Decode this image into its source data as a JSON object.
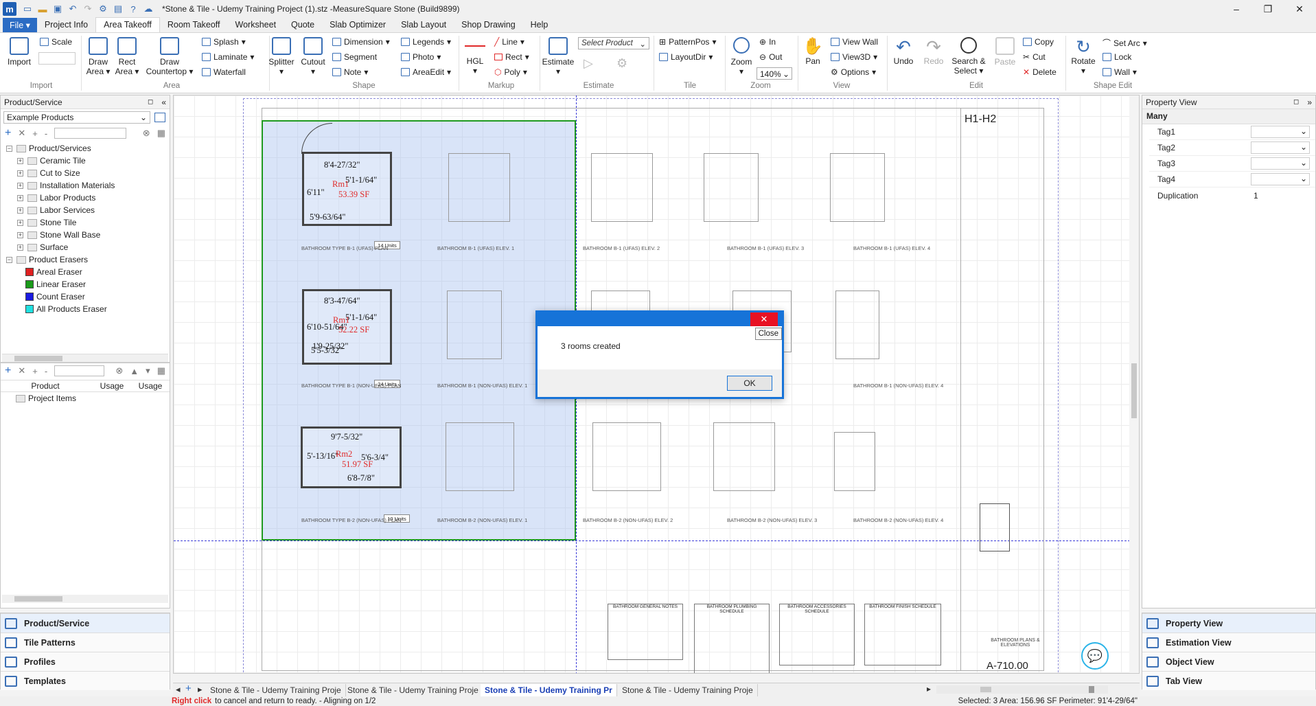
{
  "window": {
    "title": "*Stone & Tile - Udemy Training Project (1).stz -MeasureSquare Stone (Build9899)",
    "logo": "m",
    "minimize": "–",
    "restore": "❐",
    "close": "✕"
  },
  "menu": [
    "File ▾",
    "Project Info",
    "Area Takeoff",
    "Room Takeoff",
    "Worksheet",
    "Quote",
    "Slab Optimizer",
    "Slab Layout",
    "Shop Drawing",
    "Help"
  ],
  "ribbon": {
    "import": "Import",
    "scale": "Scale",
    "draw_area": "Draw\nArea ▾",
    "rect_area": "Rect\nArea ▾",
    "draw_countertop": "Draw\nCountertop ▾",
    "splash": "Splash",
    "laminate": "Laminate",
    "waterfall": "Waterfall",
    "splitter": "Splitter",
    "cutout": "Cutout",
    "dimension": "Dimension",
    "segment": "Segment",
    "note": "Note",
    "legends": "Legends",
    "photo": "Photo",
    "areaedit": "AreaEdit",
    "hgl": "HGL",
    "line": "Line",
    "rect": "Rect",
    "poly": "Poly",
    "estimate": "Estimate",
    "select_product": "Select Product",
    "patternpos": "PatternPos",
    "layoutdir": "LayoutDir",
    "zoom": "Zoom",
    "zoom_in": "In",
    "zoom_out": "Out",
    "zoom_level": "140%",
    "pan": "Pan",
    "view_wall": "View Wall",
    "view3d": "View3D",
    "options": "Options",
    "undo": "Undo",
    "redo": "Redo",
    "search_select": "Search &\nSelect ▾",
    "paste": "Paste",
    "copy": "Copy",
    "cut": "Cut",
    "delete": "Delete",
    "rotate": "Rotate",
    "set_arc": "Set Arc",
    "lock": "Lock",
    "wall": "Wall",
    "groups": {
      "import": "Import",
      "area": "Area",
      "shape": "Shape",
      "markup": "Markup",
      "estimate": "Estimate",
      "tile": "Tile",
      "zoom": "Zoom",
      "view": "View",
      "edit": "Edit",
      "shape_edit": "Shape Edit"
    }
  },
  "left_panel": {
    "title": "Product/Service",
    "dropdown": "Example Products",
    "tree_root": "Product/Services",
    "items": [
      "Ceramic Tile",
      "Cut to Size",
      "Installation Materials",
      "Labor Products",
      "Labor Services",
      "Stone Tile",
      "Stone Wall Base",
      "Surface"
    ],
    "erasers_root": "Product Erasers",
    "erasers": [
      {
        "label": "Areal Eraser",
        "color": "#e02020"
      },
      {
        "label": "Linear Eraser",
        "color": "#1a9a1a"
      },
      {
        "label": "Count Eraser",
        "color": "#1a1ae0"
      },
      {
        "label": "All Products Eraser",
        "color": "#20e0e0"
      }
    ],
    "columns": [
      "Product",
      "Usage",
      "Usage"
    ],
    "project_items": "Project Items",
    "nav": [
      "Product/Service",
      "Tile Patterns",
      "Profiles",
      "Templates"
    ]
  },
  "right_panel": {
    "title": "Property View",
    "selection": "Many",
    "props": [
      {
        "label": "Tag1",
        "value": ""
      },
      {
        "label": "Tag2",
        "value": ""
      },
      {
        "label": "Tag3",
        "value": ""
      },
      {
        "label": "Tag4",
        "value": ""
      },
      {
        "label": "Duplication",
        "value": "1"
      }
    ],
    "nav": [
      "Property View",
      "Estimation View",
      "Object View",
      "Tab View"
    ]
  },
  "drawing": {
    "sheet_id": "H1-H2",
    "sheet_number": "A-710.00",
    "rooms": [
      {
        "top": "8'4-27/32\"",
        "right": "5'1-1/64\"",
        "left": "6'11\"",
        "bottom": "5'9-63/64\"",
        "name": "Rm1",
        "area": "53.39 SF",
        "units": "14 Units"
      },
      {
        "top": "8'3-47/64\"",
        "right": "5'1-1/64\"",
        "left": "6'10-51/64\"",
        "bottom": "5'5-3/32\"",
        "bottom2": "1'9-25/32\"",
        "name": "Rm1",
        "area": "52.22 SF",
        "units": "24 Units"
      },
      {
        "top": "9'7-5/32\"",
        "right": "5'6-3/4\"",
        "left": "5'-13/16\"",
        "bottom": "6'8-7/8\"",
        "name": "Rm2",
        "area": "51.97 SF",
        "units": "10 Units"
      }
    ],
    "captions": [
      "BATHROOM TYPE B-1 (UFAS) PLAN",
      "BATHROOM B-1 (UFAS) ELEV. 1",
      "BATHROOM B-1 (UFAS) ELEV. 2",
      "BATHROOM B-1 (UFAS) ELEV. 3",
      "BATHROOM B-1 (UFAS) ELEV. 4",
      "BATHROOM TYPE B-1 (NON-UFAS) PLAN",
      "BATHROOM B-1 (NON-UFAS) ELEV. 1",
      "BATHROOM B-1 (NON-UFAS) ELEV. 4",
      "BATHROOM TYPE B-2 (NON-UFAS) PLAN",
      "BATHROOM B-2 (NON-UFAS) ELEV. 1",
      "BATHROOM B-2 (NON-UFAS) ELEV. 2",
      "BATHROOM B-2 (NON-UFAS) ELEV. 3",
      "BATHROOM B-2 (NON-UFAS) ELEV. 4"
    ],
    "schedules": [
      "BATHROOM GENERAL NOTES",
      "BATHROOM PLUMBING SCHEDULE",
      "BATHROOM ACCESSORIES SCHEDULE",
      "BATHROOM FINISH SCHEDULE"
    ],
    "title_block": "BATHROOM PLANS & ELEVATIONS"
  },
  "dialog": {
    "message": "3 rooms created",
    "ok": "OK",
    "close_tooltip": "Close",
    "close_x": "✕"
  },
  "tabs": [
    {
      "label": "Stone & Tile - Udemy Training Proje",
      "active": false
    },
    {
      "label": "Stone & Tile - Udemy Training Proje",
      "active": false
    },
    {
      "label": "Stone & Tile - Udemy Training Pr",
      "active": true
    },
    {
      "label": "Stone & Tile - Udemy Training Proje",
      "active": false
    }
  ],
  "status": {
    "hint_key": "Right click",
    "hint_rest": " to cancel and return to ready. - Aligning on 1/2",
    "selection": "Selected: 3 Area: 156.96 SF Perimeter: 91'4-29/64\""
  },
  "colors": {
    "accent": "#2b6cc4",
    "selection_fill": "#c7d6f3",
    "selection_border": "#1f9a1f",
    "dialog_border": "#1673d8",
    "close_red": "#e81123"
  }
}
